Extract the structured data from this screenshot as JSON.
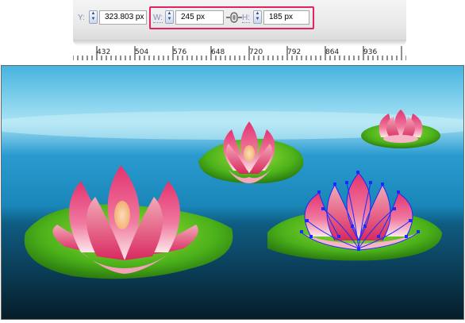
{
  "toolbar": {
    "y_label": "Y:",
    "y_value": "323.803 px",
    "w_label": "W:",
    "w_value": "245 px",
    "h_label": "H:",
    "h_value": "185 px",
    "highlight_color": "#e2245c"
  },
  "ruler": {
    "ticks": [
      "432",
      "504",
      "576",
      "648",
      "720",
      "792",
      "864",
      "936"
    ]
  },
  "canvas": {
    "colors": {
      "water_top": "#6ec8ea",
      "water_mid": "#1d8cbf",
      "water_bottom": "#0a2a3a",
      "pad": "#4fb31a",
      "petal": "#e8457c",
      "petal_light": "#fde4e8",
      "selection": "#1a2bff"
    }
  }
}
